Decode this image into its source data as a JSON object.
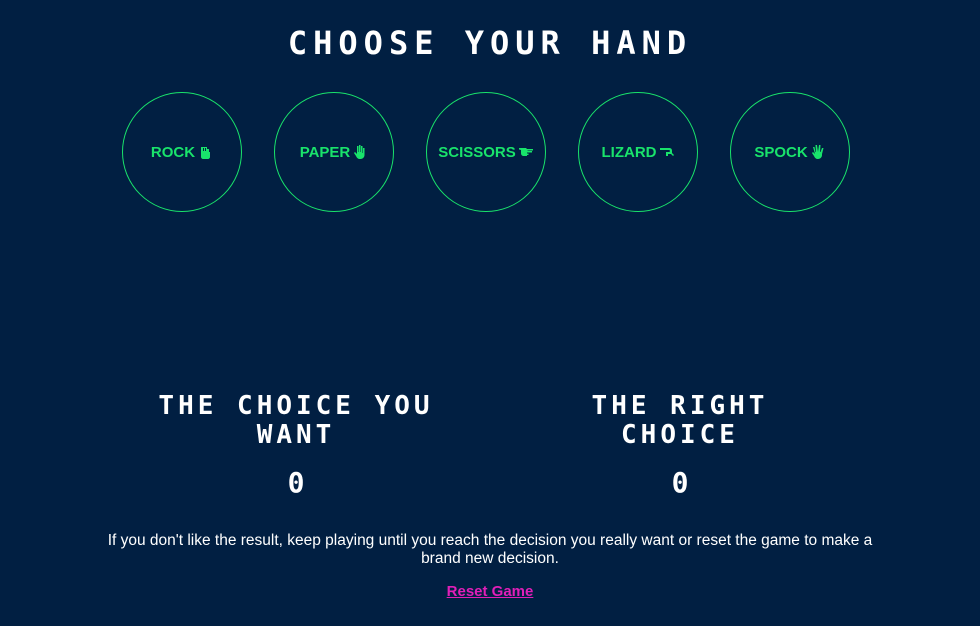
{
  "title": "CHOOSE YOUR HAND",
  "hands": [
    {
      "label": "ROCK",
      "icon": "fist-hand-icon"
    },
    {
      "label": "PAPER",
      "icon": "open-hand-icon"
    },
    {
      "label": "SCISSORS",
      "icon": "scissors-hand-icon"
    },
    {
      "label": "LIZARD",
      "icon": "lizard-hand-icon"
    },
    {
      "label": "SPOCK",
      "icon": "vulcan-salute-icon"
    }
  ],
  "scores": {
    "player": {
      "title": "THE CHOICE YOU WANT",
      "value": "0"
    },
    "right": {
      "title": "THE RIGHT CHOICE",
      "value": "0"
    }
  },
  "note": "If you don't like the result, keep playing until you reach the decision you really want or reset the game to make a brand new decision.",
  "reset_label": "Reset Game",
  "colors": {
    "background": "#011f42",
    "accent_green": "#19e36b",
    "reset_magenta": "#e01fb8",
    "text": "#ffffff"
  }
}
